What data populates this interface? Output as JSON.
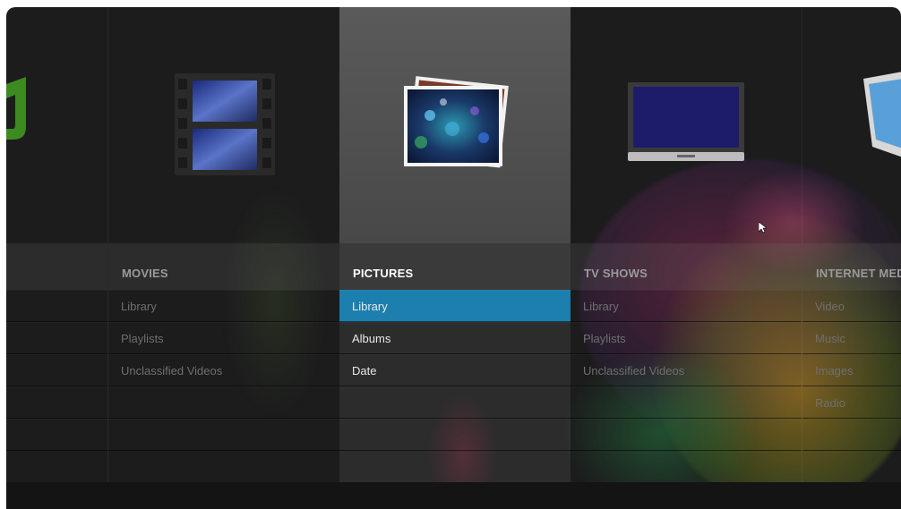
{
  "columns": [
    {
      "title": "",
      "items": []
    },
    {
      "title": "MOVIES",
      "items": [
        "Library",
        "Playlists",
        "Unclassified Videos"
      ]
    },
    {
      "title": "PICTURES",
      "items": [
        "Library",
        "Albums",
        "Date"
      ],
      "selected_index": 0
    },
    {
      "title": "TV SHOWS",
      "items": [
        "Library",
        "Playlists",
        "Unclassified Videos"
      ]
    },
    {
      "title": "INTERNET MEDIA",
      "items": [
        "Video",
        "Music",
        "Images",
        "Radio"
      ]
    }
  ],
  "icons": {
    "music": "music-note-icon",
    "movies": "film-strip-icon",
    "pictures": "photo-stack-icon",
    "tv": "television-icon",
    "internet": "tablet-icon"
  },
  "colors": {
    "selection": "#1d7fae",
    "active_column": "#4a4a4a",
    "background": "#1c1c1d"
  }
}
